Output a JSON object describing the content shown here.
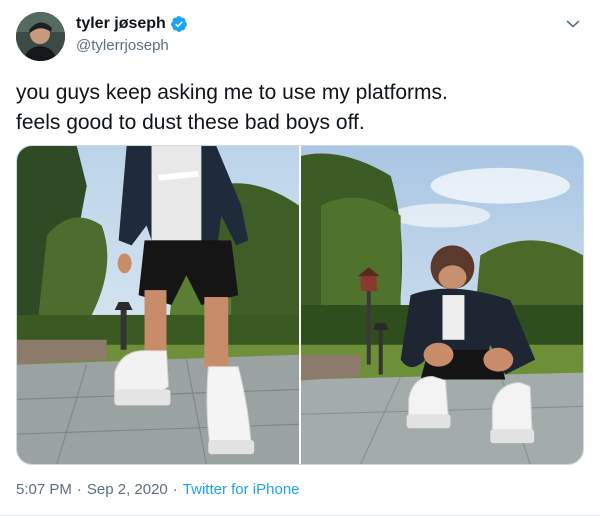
{
  "user": {
    "display_name": "tyler jøseph",
    "handle": "@tylerrjoseph",
    "verified": true,
    "avatar_icon": "profile-photo"
  },
  "tweet": {
    "text_lines": [
      "you guys keep asking me to use my platforms.",
      "feels good to dust these bad boys off."
    ]
  },
  "media": {
    "count": 2,
    "items": [
      {
        "icon": "photo-standing-in-platform-shoes"
      },
      {
        "icon": "photo-crouching-tying-platform-shoes"
      }
    ]
  },
  "meta": {
    "time": "5:07 PM",
    "separator": "·",
    "date": "Sep 2, 2020",
    "source": "Twitter for iPhone"
  },
  "colors": {
    "text": "#0f1419",
    "secondary": "#5b7083",
    "link": "#1da1f2",
    "verified": "#1da1f2",
    "border": "#cfd9de"
  }
}
